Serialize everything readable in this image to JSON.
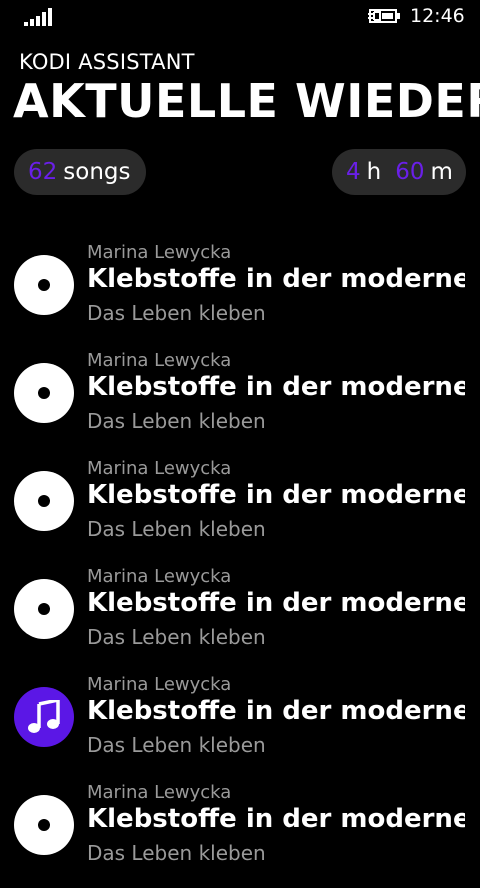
{
  "status_bar": {
    "time": "12:46",
    "icons": [
      "signal-strength-icon",
      "battery-charging-icon"
    ]
  },
  "header": {
    "app_title": "KODI ASSISTANT",
    "page_title": "AKTUELLE WIEDERGABE"
  },
  "stats": {
    "songs_count": "62",
    "songs_label": "songs",
    "hours_value": "4",
    "hours_unit": "h",
    "minutes_value": "60",
    "minutes_unit": "m"
  },
  "colors": {
    "accent": "#6a1fe8",
    "playing_icon_bg": "#5b17e6",
    "pill_bg": "#2b2b2b",
    "secondary_text": "#9a9a9a"
  },
  "songs": [
    {
      "artist": "Marina Lewycka",
      "title": "Klebstoffe in der modernen",
      "album": "Das Leben kleben",
      "icon": "disc-icon"
    },
    {
      "artist": "Marina Lewycka",
      "title": "Klebstoffe in der modernen",
      "album": "Das Leben kleben",
      "icon": "disc-icon"
    },
    {
      "artist": "Marina Lewycka",
      "title": "Klebstoffe in der modernen",
      "album": "Das Leben kleben",
      "icon": "disc-icon"
    },
    {
      "artist": "Marina Lewycka",
      "title": "Klebstoffe in der modernen",
      "album": "Das Leben kleben",
      "icon": "disc-icon"
    },
    {
      "artist": "Marina Lewycka",
      "title": "Klebstoffe in der modernen",
      "album": "Das Leben kleben",
      "icon": "music-note-icon"
    },
    {
      "artist": "Marina Lewycka",
      "title": "Klebstoffe in der modernen",
      "album": "Das Leben kleben",
      "icon": "disc-icon"
    }
  ]
}
